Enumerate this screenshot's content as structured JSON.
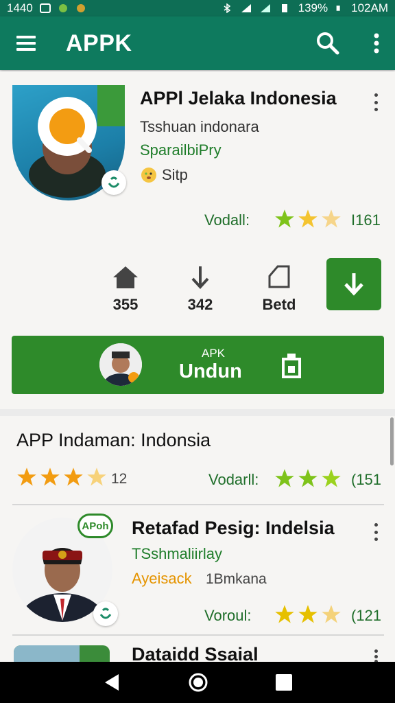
{
  "status_bar": {
    "time_left": "1440",
    "battery": "139%",
    "clock": "102AM"
  },
  "app_bar": {
    "title": "APPK"
  },
  "featured": {
    "title": "APPl Jelaka Indonesia",
    "subtitle": "Tsshuan indonara",
    "category": "SparailbiPry",
    "tag": "Sitp",
    "rating_label": "Vodall:",
    "rating_count": "I161",
    "rating_stars": 3,
    "stats": [
      {
        "icon": "home-icon",
        "value": "355"
      },
      {
        "icon": "download-arrow-icon",
        "value": "342"
      },
      {
        "icon": "tag-icon",
        "value": "Betd"
      }
    ],
    "download_button": {
      "small_label": "APK",
      "large_label": "Undun"
    }
  },
  "list": {
    "section_title": "APP Indaman: Indonsia",
    "section_rating": {
      "stars": 3.5,
      "count": "12",
      "label": "Vodarll:",
      "count_right": "(151"
    },
    "items": [
      {
        "badge": "APoh",
        "title": "Retafad Pesig: Indelsia",
        "subtitle": "TSshmaliirlay",
        "developer": "Ayeisack",
        "size": "1Bmkana",
        "rating_label": "Voroul:",
        "rating_count": "(121",
        "stars": 3
      },
      {
        "title": "Dataidd Ssaial"
      }
    ]
  },
  "colors": {
    "primary": "#0e7a5e",
    "accent": "#2e8a2a",
    "star": "#f2c200"
  }
}
